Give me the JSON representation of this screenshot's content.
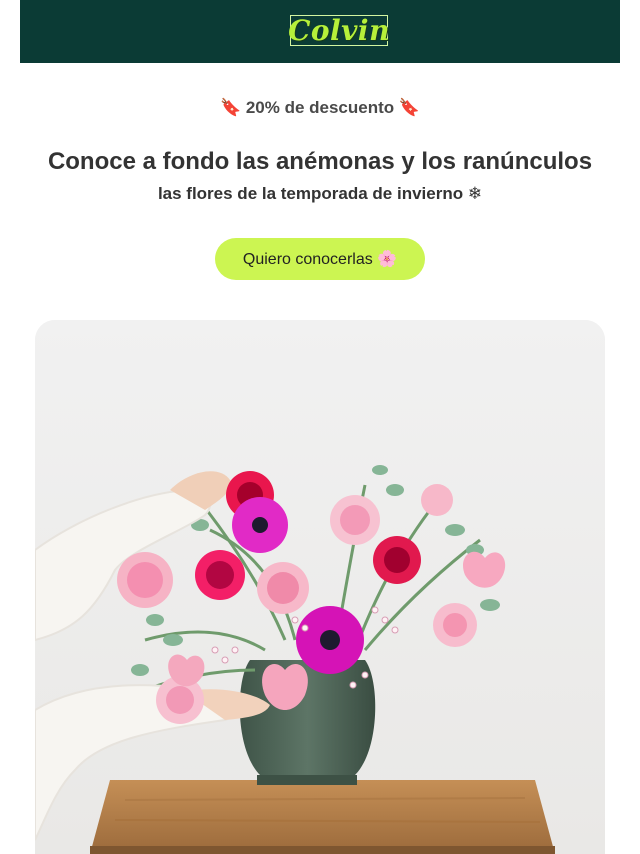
{
  "brand": {
    "logo_text": "Colvin"
  },
  "promo": {
    "text": "🔖 20% de descuento 🔖"
  },
  "hero": {
    "headline": "Conoce a fondo las anémonas y los ranúnculos",
    "subheadline": "las flores de la temporada de invierno ❄",
    "cta_label": "Quiero conocerlas 🌸",
    "image_alt": "Arreglo floral de anémonas y ranúnculos"
  },
  "colors": {
    "header_bg": "#0b3b35",
    "logo_text": "#b6f03a",
    "cta_bg": "#ccf552"
  }
}
